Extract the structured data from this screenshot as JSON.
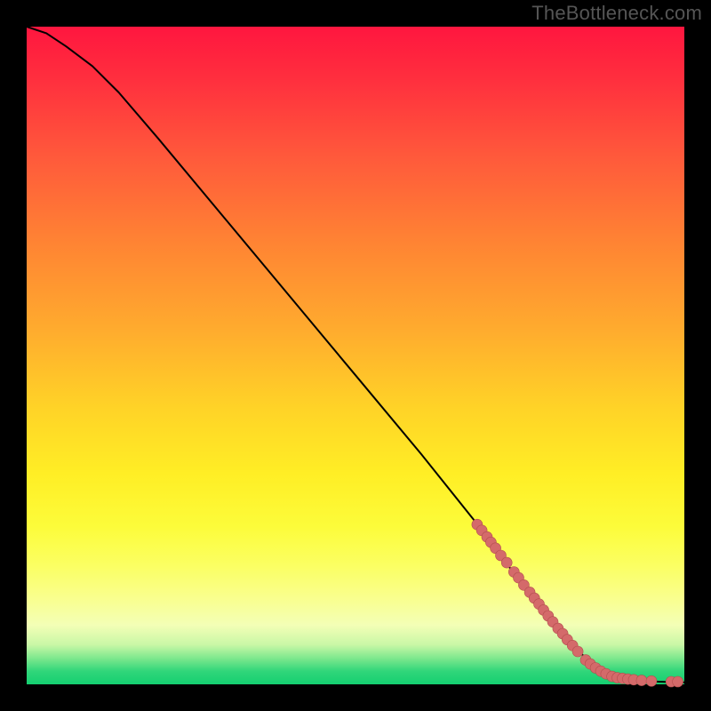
{
  "watermark": "TheBottleneck.com",
  "colors": {
    "dot_fill": "#d46a6a",
    "dot_stroke": "#b24d4d",
    "curve": "#000000"
  },
  "chart_data": {
    "type": "line",
    "title": "",
    "xlabel": "",
    "ylabel": "",
    "xlim": [
      0,
      100
    ],
    "ylim": [
      0,
      100
    ],
    "grid": false,
    "legend": false,
    "series": [
      {
        "name": "curve",
        "style": "line",
        "x": [
          0,
          3,
          6,
          10,
          14,
          20,
          30,
          40,
          50,
          60,
          68,
          74,
          78,
          82,
          85,
          88,
          92,
          96,
          100
        ],
        "y": [
          100,
          99,
          97,
          94,
          90,
          83,
          71,
          59,
          47,
          35,
          25,
          17,
          12,
          7,
          4,
          2,
          0.8,
          0.4,
          0.3
        ]
      },
      {
        "name": "points",
        "style": "scatter",
        "x": [
          68.5,
          69.2,
          70.0,
          70.6,
          71.3,
          72.1,
          73.0,
          74.1,
          74.8,
          75.6,
          76.5,
          77.2,
          77.9,
          78.6,
          79.3,
          80.0,
          80.8,
          81.5,
          82.2,
          83.0,
          83.8,
          85.0,
          85.7,
          86.5,
          87.3,
          88.1,
          89.0,
          89.8,
          90.6,
          91.4,
          92.3,
          93.5,
          95.0,
          98.0,
          99.0
        ],
        "y": [
          24.3,
          23.4,
          22.4,
          21.6,
          20.7,
          19.6,
          18.5,
          17.1,
          16.2,
          15.1,
          14.0,
          13.1,
          12.2,
          11.3,
          10.4,
          9.5,
          8.5,
          7.7,
          6.8,
          5.9,
          5.0,
          3.7,
          3.1,
          2.5,
          2.0,
          1.6,
          1.2,
          1.0,
          0.9,
          0.8,
          0.7,
          0.6,
          0.5,
          0.4,
          0.4
        ]
      }
    ]
  }
}
